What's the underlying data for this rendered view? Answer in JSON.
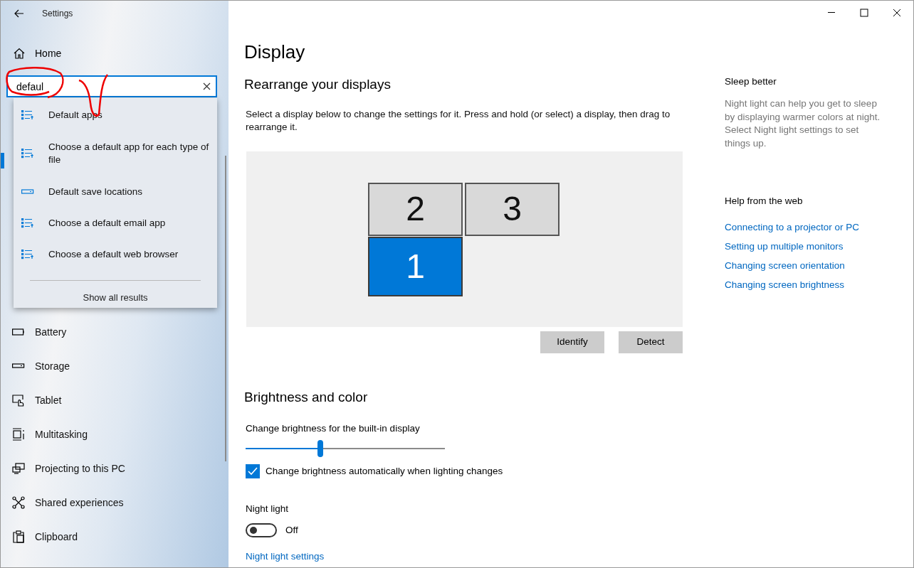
{
  "window": {
    "title": "Settings"
  },
  "sidebar": {
    "home": "Home",
    "search": {
      "value": "defaul"
    },
    "suggestions": [
      {
        "label": "Default apps",
        "kind": "list"
      },
      {
        "label": "Choose a default app for each type of file",
        "kind": "list"
      },
      {
        "label": "Default save locations",
        "kind": "drive"
      },
      {
        "label": "Choose a default email app",
        "kind": "list"
      },
      {
        "label": "Choose a default web browser",
        "kind": "list"
      }
    ],
    "show_all": "Show all results",
    "items": [
      {
        "label": "Battery",
        "kind": "battery"
      },
      {
        "label": "Storage",
        "kind": "storage"
      },
      {
        "label": "Tablet",
        "kind": "tablet"
      },
      {
        "label": "Multitasking",
        "kind": "multitasking"
      },
      {
        "label": "Projecting to this PC",
        "kind": "projecting"
      },
      {
        "label": "Shared experiences",
        "kind": "shared"
      },
      {
        "label": "Clipboard",
        "kind": "clipboard"
      }
    ]
  },
  "page": {
    "title": "Display",
    "rearrange": {
      "heading": "Rearrange your displays",
      "description": "Select a display below to change the settings for it. Press and hold (or select) a display, then drag to rearrange it.",
      "displays": [
        {
          "number": "2",
          "selected": false
        },
        {
          "number": "3",
          "selected": false
        },
        {
          "number": "1",
          "selected": true
        }
      ],
      "buttons": [
        "Identify",
        "Detect"
      ]
    },
    "brightness": {
      "heading": "Brightness and color",
      "slider_label": "Change brightness for the built-in display",
      "level": 0.375,
      "auto": {
        "label": "Change brightness automatically when lighting changes",
        "checked": true
      },
      "night_light": {
        "label": "Night light",
        "on": false,
        "state_text": "Off"
      },
      "link": "Night light settings"
    }
  },
  "aside": {
    "sleep": {
      "heading": "Sleep better",
      "text": "Night light can help you get to sleep by displaying warmer colors at night. Select Night light settings to set things up."
    },
    "help": {
      "heading": "Help from the web",
      "links": [
        "Connecting to a projector or PC",
        "Setting up multiple monitors",
        "Changing screen orientation",
        "Changing screen brightness"
      ]
    }
  }
}
